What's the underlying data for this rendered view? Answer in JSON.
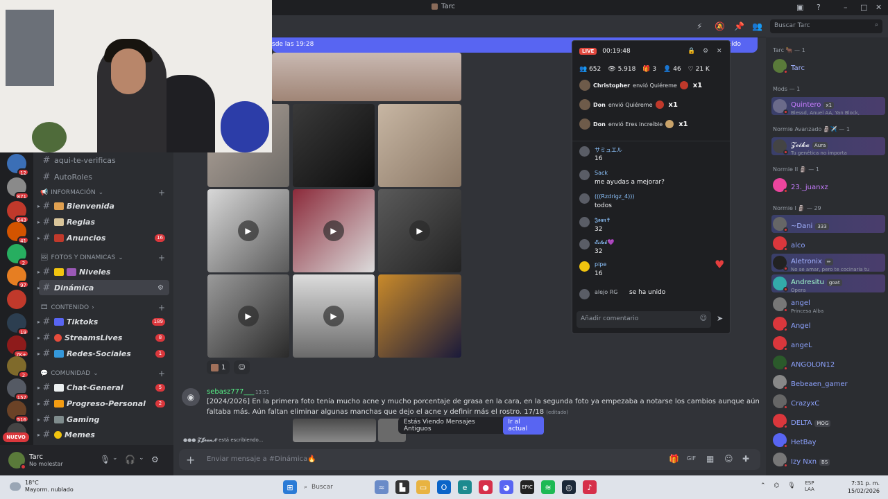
{
  "titlebar": {
    "title": "Tarc"
  },
  "header": {
    "search_placeholder": "Buscar Tarc"
  },
  "newbar": {
    "left_text": "sde las 19:28",
    "right_text": "Marcar como leído"
  },
  "servers": [
    {
      "badge": "12",
      "color": "#3b6fb6"
    },
    {
      "badge": "871",
      "color": "#8a8a8a"
    },
    {
      "badge": "643",
      "color": "#c0392b"
    },
    {
      "badge": "41",
      "color": "#d35400"
    },
    {
      "badge": "2",
      "color": "#27ae60"
    },
    {
      "badge": "97",
      "color": "#e67e22"
    },
    {
      "badge": "",
      "color": "#c0392b"
    },
    {
      "badge": "19",
      "color": "#2c3e50"
    },
    {
      "badge": "7K+",
      "color": "#8e1b1b"
    },
    {
      "badge": "2",
      "color": "#7f6a2b"
    },
    {
      "badge": "157",
      "color": "#555a64"
    },
    {
      "badge": "516",
      "color": "#6b4226"
    },
    {
      "badge": "",
      "color": "#444"
    }
  ],
  "nuevo_label": "NUEVO",
  "channels": {
    "top_partial": "aqui-te-verificas",
    "autoroles": "AutoRoles",
    "cat_info": "INFORMACIÓN",
    "bienvenida": "Bienvenida",
    "reglas": "Reglas",
    "anuncios": "Anuncios",
    "anuncios_badge": "16",
    "cat_fotos": "FOTOS Y DINAMICAS",
    "niveles": "Niveles",
    "dinamica": "Dinámica",
    "cat_contenido": "CONTENIDO",
    "tiktoks": "Tiktoks",
    "tiktoks_badge": "189",
    "streamslives": "StreamsLives",
    "streamslives_badge": "8",
    "redes": "Redes-Sociales",
    "redes_badge": "1",
    "cat_comunidad": "COMUNIDAD",
    "chatgeneral": "Chat-General",
    "chatgeneral_badge": "5",
    "progreso": "Progreso-Personal",
    "progreso_badge": "2",
    "gaming": "Gaming",
    "memes": "Memes"
  },
  "user": {
    "name": "Tarc",
    "status": "No molestar"
  },
  "reactions": [
    {
      "count": "1"
    }
  ],
  "message": {
    "author": "sebasz777___",
    "time": "13:51",
    "text": "[2024/2026] En la primera foto tenía mucho acne y mucho porcentaje de grasa en la cara, en la segunda foto ya empezaba a notarse los cambios aunque aún faltaba más. Aún faltan eliminar algunas manchas que dejo el acne y definir más el rostro. 17/18",
    "edited": "(editado)"
  },
  "old_messages": {
    "text": "Estás Viendo Mensajes Antiguos",
    "button": "Ir al actual"
  },
  "typing": {
    "user": "𝓩𝓙𝓮𝓪𝓷𝓝",
    "text": "está escribiendo..."
  },
  "input": {
    "placeholder": "Enviar mensaje a #Dinámica🔥"
  },
  "live": {
    "tag": "LIVE",
    "timer": "00:19:48",
    "stats": [
      "652",
      "5.918",
      "3",
      "46",
      "21 K"
    ],
    "gifts": [
      {
        "user": "Christopher",
        "text": "envió Quiéreme",
        "mult": "x1"
      },
      {
        "user": "Don",
        "text": "envió Quiéreme",
        "mult": "x1"
      },
      {
        "user": "Don",
        "text": "envió Eres increíble",
        "mult": "x1"
      }
    ],
    "comments": [
      {
        "user": "サミュエル",
        "text": "16"
      },
      {
        "user": "Sack",
        "text": "me ayudas a mejorar?"
      },
      {
        "user": "(((Rzdrigz_4)))",
        "text": "todos"
      },
      {
        "user": "𝕵𝖔𝖆𝖓✝",
        "text": "32"
      },
      {
        "user": "𝓔𝓼𝓽𝓮𝓫💜",
        "text": "32"
      },
      {
        "user": "pipe",
        "text": "16"
      },
      {
        "user": "alejo RG",
        "text": "se ha unido"
      }
    ],
    "comment_placeholder": "Añadir comentario"
  },
  "members": {
    "groups": [
      {
        "label": "Tarc 🐂 — 1"
      },
      {
        "label": "Mods — 1"
      },
      {
        "label": "Normie Avanzado 🗿✈️ — 1"
      },
      {
        "label": "Normie II 🗿 — 1"
      },
      {
        "label": "Normie I 🗿 — 29"
      }
    ],
    "list": [
      {
        "name": "Tarc",
        "sub": "",
        "color": "#a3b3ff",
        "av": "#5a7a3a",
        "tag": ""
      },
      {
        "name": "Quintero",
        "sub": "Blessd, Anuel AA, Yan Block,",
        "color": "#c77dff",
        "av": "#6b6b8a",
        "tag": "x1"
      },
      {
        "name": "𝓩𝓮𝓲𝓴𝓪",
        "sub": "Tu genética no importa",
        "color": "#f2f3f5",
        "av": "#444",
        "tag": "Aura"
      },
      {
        "name": "23._juanxz",
        "sub": "",
        "color": "#c77dff",
        "av": "#eb459e",
        "tag": ""
      },
      {
        "name": "~Dani",
        "sub": "",
        "color": "#a3b3ff",
        "av": "#666",
        "tag": "333"
      },
      {
        "name": "alco",
        "sub": "",
        "color": "#8ea3ff",
        "av": "#da373c",
        "tag": ""
      },
      {
        "name": "Aletronix",
        "sub": "No se amar, pero te cocinaria tu",
        "color": "#a3b3ff",
        "av": "#222",
        "tag": "✏"
      },
      {
        "name": "Andresitu",
        "sub": "Opera",
        "color": "#a3ffcf",
        "av": "#3aa",
        "tag": "goat"
      },
      {
        "name": "angel",
        "sub": "Princesa Alba",
        "color": "#8ea3ff",
        "av": "#777",
        "tag": ""
      },
      {
        "name": "Angel",
        "sub": "",
        "color": "#8ea3ff",
        "av": "#da373c",
        "tag": ""
      },
      {
        "name": "angeL",
        "sub": "",
        "color": "#8ea3ff",
        "av": "#da373c",
        "tag": ""
      },
      {
        "name": "ANGOLON12",
        "sub": "",
        "color": "#8ea3ff",
        "av": "#2b5a2b",
        "tag": ""
      },
      {
        "name": "Bebeaen_gamer",
        "sub": "",
        "color": "#8ea3ff",
        "av": "#888",
        "tag": ""
      },
      {
        "name": "CrazyxC",
        "sub": "",
        "color": "#8ea3ff",
        "av": "#666",
        "tag": ""
      },
      {
        "name": "DELTA",
        "sub": "",
        "color": "#8ea3ff",
        "av": "#da373c",
        "tag": "MOG"
      },
      {
        "name": "HetBay",
        "sub": "",
        "color": "#8ea3ff",
        "av": "#5865f2",
        "tag": ""
      },
      {
        "name": "Izy Nxn",
        "sub": "",
        "color": "#8ea3ff",
        "av": "#777",
        "tag": "BS"
      }
    ]
  },
  "taskbar": {
    "temp": "18°C",
    "weather": "Mayorm. nublado",
    "search": "Buscar",
    "lang1": "ESP",
    "lang2": "LAA",
    "time": "7:31 p. m.",
    "date": "15/02/2026"
  }
}
